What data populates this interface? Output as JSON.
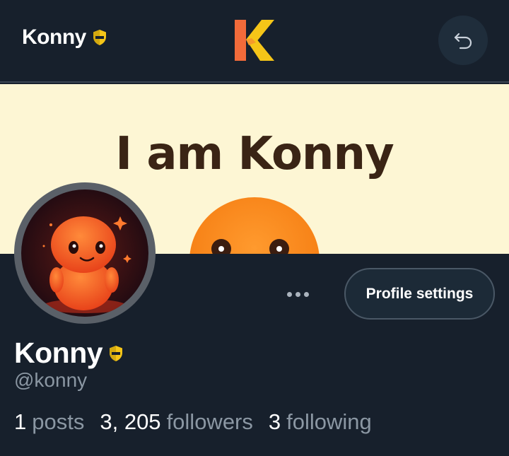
{
  "header": {
    "brand_name": "Konny",
    "logo_letter": "K",
    "back_icon": "undo-arrow-icon",
    "verified_icon": "shield-check-icon"
  },
  "banner": {
    "title": "I am Konny"
  },
  "profile": {
    "display_name": "Konny",
    "handle": "@konny",
    "more_icon": "more-dots-icon",
    "settings_label": "Profile settings",
    "stats": [
      {
        "count": "1",
        "label": "posts"
      },
      {
        "count": "3, 205",
        "label": "followers"
      },
      {
        "count": "3",
        "label": "following"
      }
    ]
  },
  "colors": {
    "background": "#17202c",
    "banner": "#fdf6d4",
    "accent_yellow": "#f5c518",
    "logo_orange": "#f26b3a",
    "muted_text": "#8b97a3"
  }
}
